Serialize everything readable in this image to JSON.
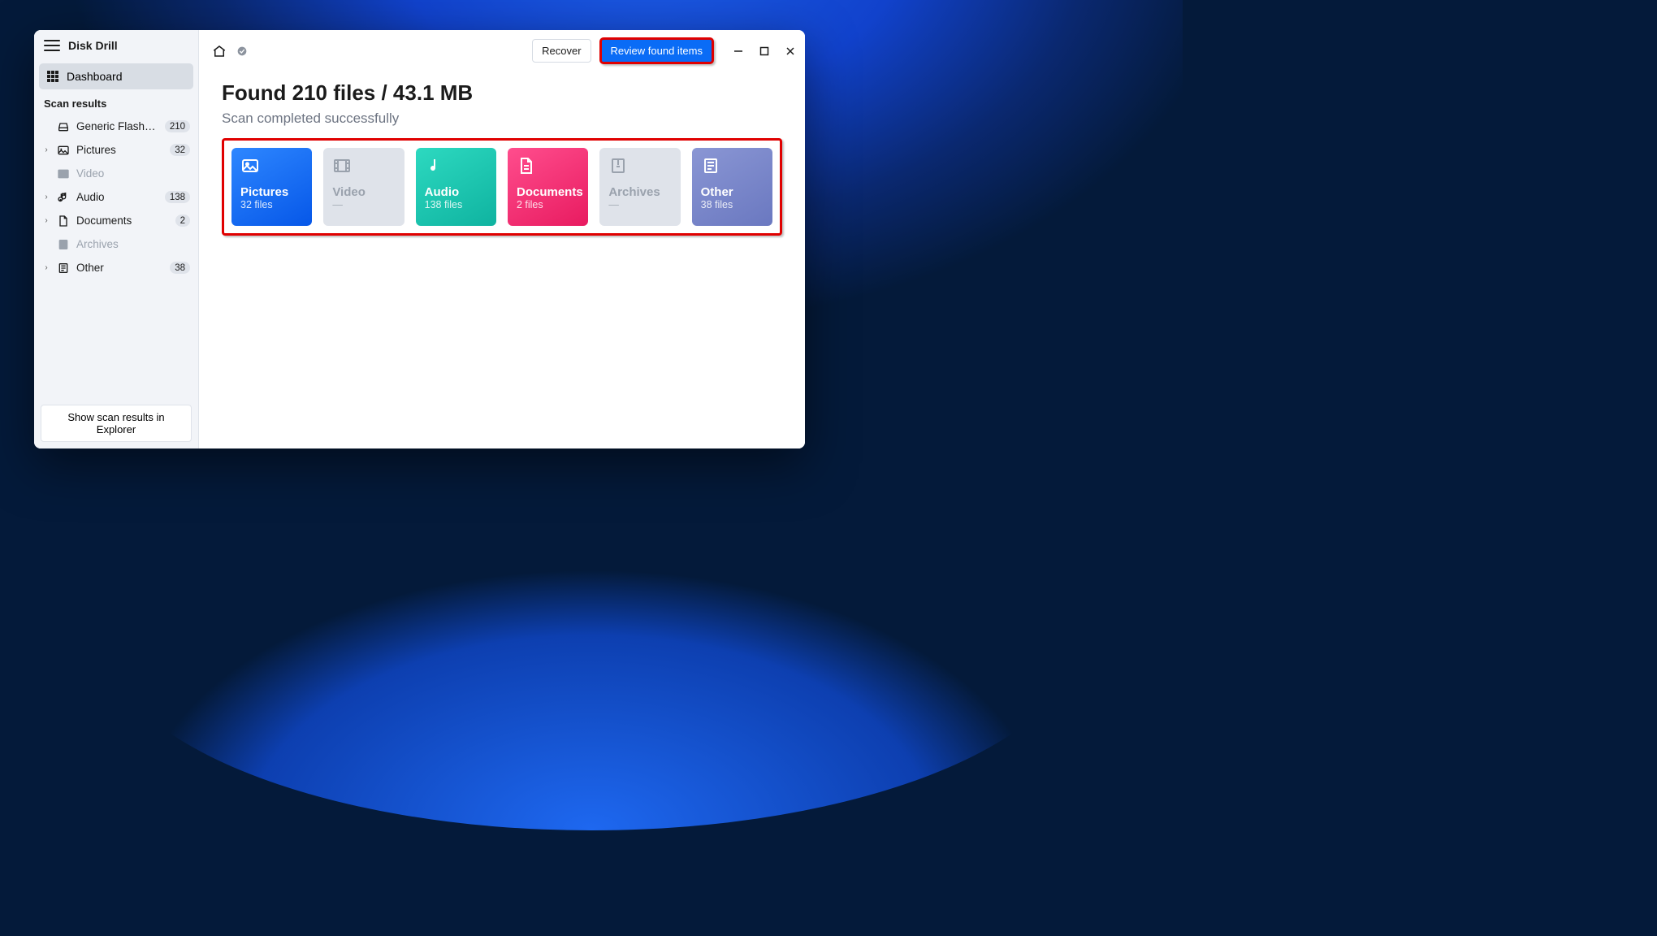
{
  "app": {
    "title": "Disk Drill"
  },
  "sidebar": {
    "dashboard_label": "Dashboard",
    "section_label": "Scan results",
    "items": [
      {
        "label": "Generic Flash Disk USB…",
        "count": "210",
        "expandable": false,
        "dim": false
      },
      {
        "label": "Pictures",
        "count": "32",
        "expandable": true,
        "dim": false
      },
      {
        "label": "Video",
        "count": "",
        "expandable": false,
        "dim": true
      },
      {
        "label": "Audio",
        "count": "138",
        "expandable": true,
        "dim": false
      },
      {
        "label": "Documents",
        "count": "2",
        "expandable": true,
        "dim": false
      },
      {
        "label": "Archives",
        "count": "",
        "expandable": false,
        "dim": true
      },
      {
        "label": "Other",
        "count": "38",
        "expandable": true,
        "dim": false
      }
    ],
    "footer_button": "Show scan results in Explorer"
  },
  "toolbar": {
    "recover_label": "Recover",
    "review_label": "Review found items"
  },
  "main": {
    "title": "Found 210 files / 43.1 MB",
    "subtitle": "Scan completed successfully",
    "cards": [
      {
        "title": "Pictures",
        "sub": "32 files",
        "style": "g-pictures",
        "empty": false
      },
      {
        "title": "Video",
        "sub": "—",
        "style": "empty",
        "empty": true
      },
      {
        "title": "Audio",
        "sub": "138 files",
        "style": "g-audio",
        "empty": false
      },
      {
        "title": "Documents",
        "sub": "2 files",
        "style": "g-docs",
        "empty": false
      },
      {
        "title": "Archives",
        "sub": "—",
        "style": "empty",
        "empty": true
      },
      {
        "title": "Other",
        "sub": "38 files",
        "style": "g-other",
        "empty": false
      }
    ]
  }
}
